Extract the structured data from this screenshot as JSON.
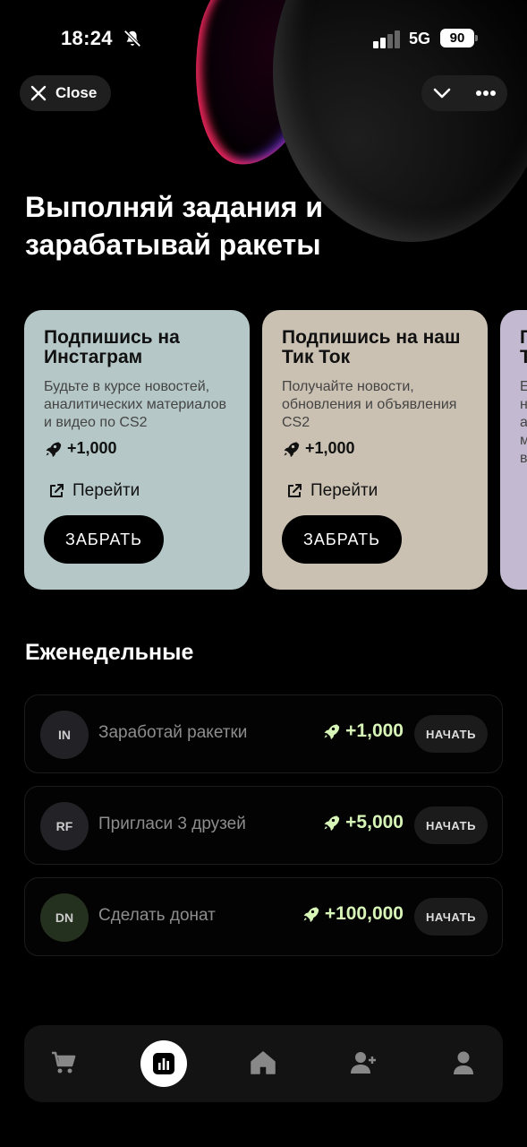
{
  "status_bar": {
    "time": "18:24",
    "network": "5G",
    "battery": "90"
  },
  "top_bar": {
    "close_label": "Close"
  },
  "hero": {
    "title": "Выполняй задания и зарабатывай ракеты"
  },
  "cards": [
    {
      "title": "Подпишись на Инстаграм",
      "description": "Будьте в курсе новостей, аналитических материалов и видео по CS2",
      "reward": "+1,000",
      "link_label": "Перейти",
      "claim_label": "ЗАБРАТЬ",
      "color": "#b5c8c7"
    },
    {
      "title": "Подпишись на наш Тик Ток",
      "description": "Получайте новости, обновления и объявления CS2",
      "reward": "+1,000",
      "link_label": "Перейти",
      "claim_label": "ЗАБРАТЬ",
      "color": "#cbc1b2"
    },
    {
      "title": "П Т",
      "description": "Е н а м в",
      "color": "#c3b9d1"
    }
  ],
  "weekly": {
    "title": "Еженедельные",
    "tasks": [
      {
        "avatar": "IN",
        "name": "Заработай ракетки",
        "reward": "+1,000",
        "action": "НАЧАТЬ",
        "avatar_color": "#222226"
      },
      {
        "avatar": "RF",
        "name": "Пригласи 3 друзей",
        "reward": "+5,000",
        "action": "НАЧАТЬ",
        "avatar_color": "#222227"
      },
      {
        "avatar": "DN",
        "name": "Сделать донат",
        "reward": "+100,000",
        "action": "НАЧАТЬ",
        "avatar_color": "#25311f"
      }
    ]
  },
  "bottom_nav": {
    "items": [
      {
        "icon": "cart-icon"
      },
      {
        "icon": "chart-icon",
        "active": true
      },
      {
        "icon": "home-icon"
      },
      {
        "icon": "add-user-icon"
      },
      {
        "icon": "profile-icon"
      }
    ]
  },
  "colors": {
    "accent_reward": "#d8f5b8",
    "background": "#000000"
  }
}
